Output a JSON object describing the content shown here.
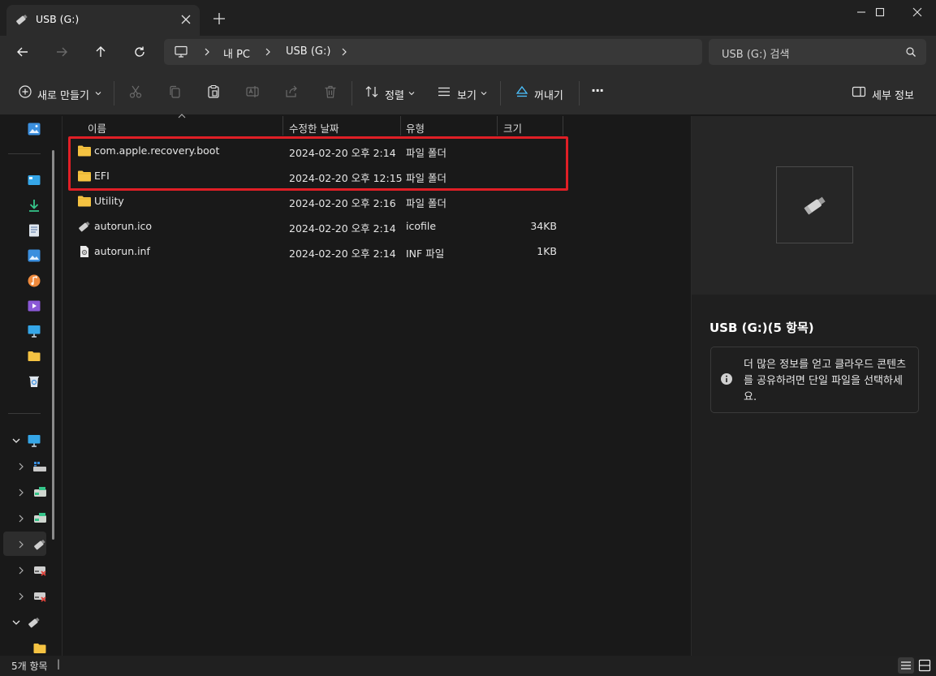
{
  "window": {
    "tab_title": "USB (G:)",
    "new_tab_label": "+"
  },
  "address": {
    "breadcrumbs": [
      "내 PC",
      "USB (G:)"
    ],
    "search_placeholder": "USB (G:) 검색"
  },
  "toolbar": {
    "new_label": "새로 만들기",
    "sort_label": "정렬",
    "view_label": "보기",
    "eject_label": "꺼내기",
    "more_label": "···",
    "details_label": "세부 정보"
  },
  "columns": {
    "name": "이름",
    "modified": "수정한 날짜",
    "type": "유형",
    "size": "크기"
  },
  "files": [
    {
      "name": "com.apple.recovery.boot",
      "modified": "2024-02-20 오후 2:14",
      "type": "파일 폴더",
      "size": "",
      "icon": "folder-icon"
    },
    {
      "name": "EFI",
      "modified": "2024-02-20 오후 12:15",
      "type": "파일 폴더",
      "size": "",
      "icon": "folder-icon"
    },
    {
      "name": "Utility",
      "modified": "2024-02-20 오후 2:16",
      "type": "파일 폴더",
      "size": "",
      "icon": "folder-icon"
    },
    {
      "name": "autorun.ico",
      "modified": "2024-02-20 오후 2:14",
      "type": "icofile",
      "size": "34KB",
      "icon": "usb-drive-icon"
    },
    {
      "name": "autorun.inf",
      "modified": "2024-02-20 오후 2:14",
      "type": "INF 파일",
      "size": "1KB",
      "icon": "settings-file-icon"
    }
  ],
  "details": {
    "title": "USB (G:)(5 항목)",
    "info": "더 많은 정보를 얻고 클라우드 콘텐츠를 공유하려면 단일 파일을 선택하세요."
  },
  "status": {
    "item_count": "5개 항목",
    "separator": "|"
  },
  "colors": {
    "highlight": "#e01f26",
    "folder": "#f5c342",
    "accent": "#4cc2ff"
  }
}
